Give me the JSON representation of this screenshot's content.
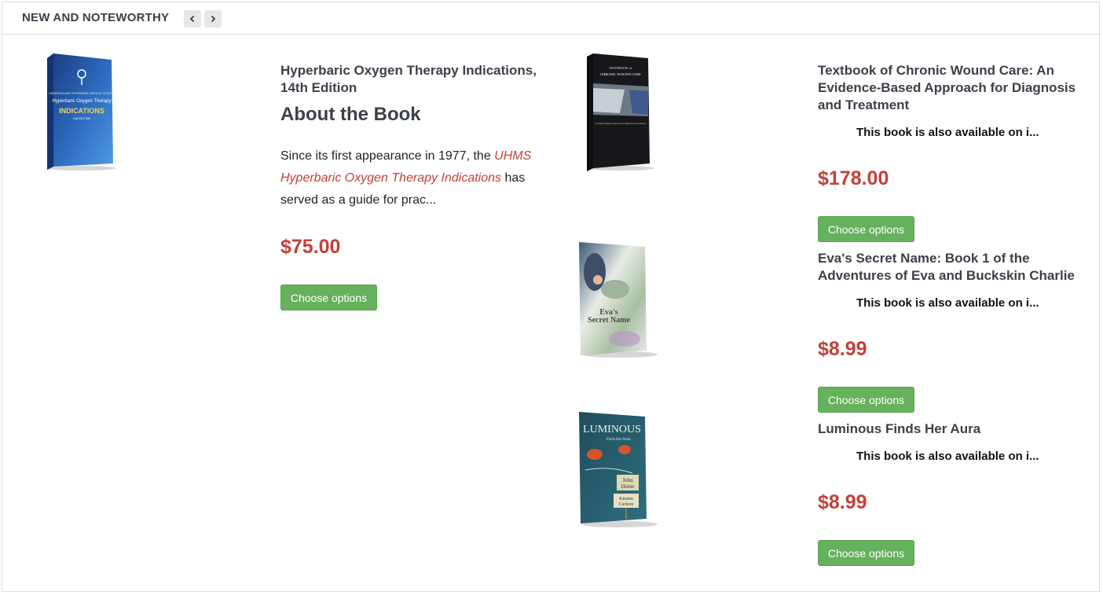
{
  "section": {
    "title": "NEW AND NOTEWORTHY",
    "prev_icon": "chevron-left-icon",
    "next_icon": "chevron-right-icon"
  },
  "featured": {
    "title_line1": "Hyperbaric Oxygen Therapy Indications,",
    "title_line2": "14th Edition",
    "about_heading": "About the Book",
    "desc_part1": "Since its first appearance in 1977, the ",
    "desc_em_line1": "UHMS",
    "desc_em_line2": "Hyperbaric Oxygen Therapy Indications",
    "desc_part2": " has",
    "desc_part3": "served as a guide for prac...",
    "price": "$75.00",
    "button": "Choose options",
    "cover": {
      "line1": "UNDERSEA AND HYPERBARIC MEDICAL SOCIETY",
      "line2": "Hyperbaric Oxygen Therapy",
      "line3": "INDICATIONS",
      "line4": "14th EDITION"
    }
  },
  "products": [
    {
      "title_lines": [
        "Textbook of Chronic Wound Care: An",
        "Evidence-Based Approach for Diagnosis",
        "and Treatment"
      ],
      "availability": "This book is also available on i...",
      "price": "$178.00",
      "button": "Choose options",
      "cover": {
        "line1": "TEXTBOOK of",
        "line2": "CHRONIC WOUND CARE",
        "line3": "An Evidence-Based Approach for Diagnosis and Treatment"
      }
    },
    {
      "title_lines": [
        "Eva's Secret Name: Book 1 of the",
        "Adventures of Eva and Buckskin Charlie"
      ],
      "availability": "This book is also available on i...",
      "price": "$8.99",
      "button": "Choose options",
      "cover": {
        "line1": "Eva's",
        "line2": "Secret Name"
      }
    },
    {
      "title_lines": [
        "Luminous Finds Her Aura"
      ],
      "availability": "This book is also available on i...",
      "price": "$8.99",
      "button": "Choose options",
      "cover": {
        "line1": "LUMINOUS",
        "line2": "Finds Her Aura",
        "line3": "John",
        "line4": "Heine",
        "line5": "Kirsten",
        "line6": "Carlson"
      }
    }
  ],
  "colors": {
    "price": "#c3403a",
    "button": "#66b15b",
    "text": "#3b4149"
  }
}
